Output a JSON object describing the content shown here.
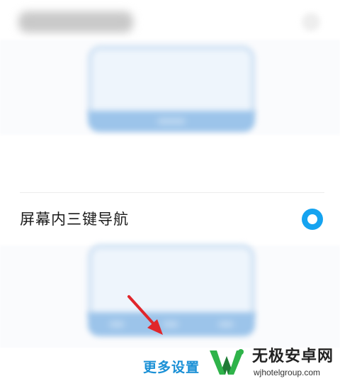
{
  "option": {
    "label": "屏幕内三键导航",
    "selected": true
  },
  "more_settings": {
    "label": "更多设置"
  },
  "watermark": {
    "title": "无极安卓网",
    "url": "wjhotelgroup.com"
  },
  "colors": {
    "accent": "#15a3f0",
    "link": "#1a90d6",
    "arrow": "#e0262b",
    "logo_green": "#2fb34a",
    "logo_dark": "#1f7a35"
  },
  "icons": {
    "radio": "radio-selected-icon",
    "annotation": "red-arrow-icon",
    "watermark_logo": "w-logo-icon"
  }
}
